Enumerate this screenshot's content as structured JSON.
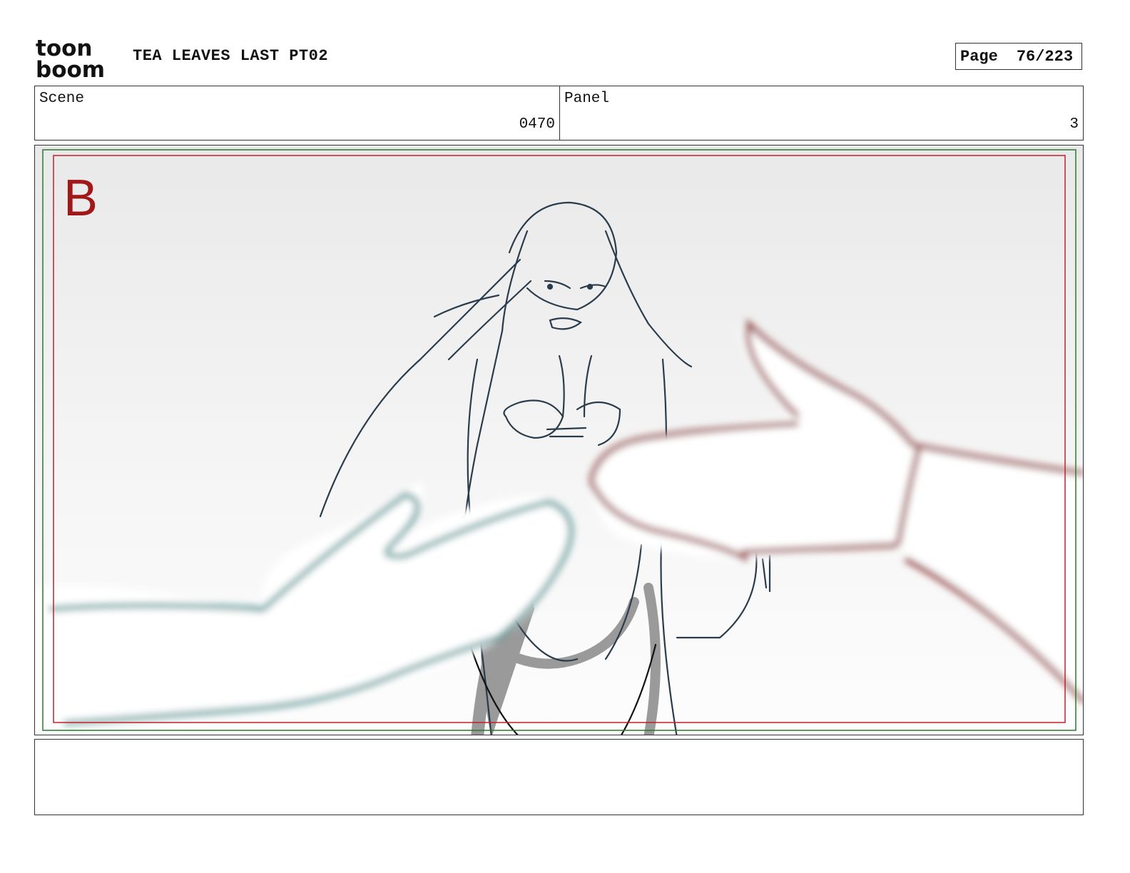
{
  "header": {
    "project_title": "TEA LEAVES LAST PT02",
    "logo_text_top": "toon",
    "logo_text_bottom": "boom",
    "page_label": "Page",
    "page_value": "76/223"
  },
  "info": {
    "scene_label": "Scene",
    "scene_value": "0470",
    "panel_label": "Panel",
    "panel_value": "3"
  },
  "frame": {
    "marker": "B",
    "colors": {
      "safe_area": "#c0202a",
      "title_safe": "#2a7a2a",
      "marker": "#a01818",
      "character_lines": "#2a3c4c",
      "left_hand": "#5f9c9c",
      "right_hand": "#9b5050",
      "shadow": "#9a9a9a"
    }
  },
  "notes": {
    "text": ""
  }
}
